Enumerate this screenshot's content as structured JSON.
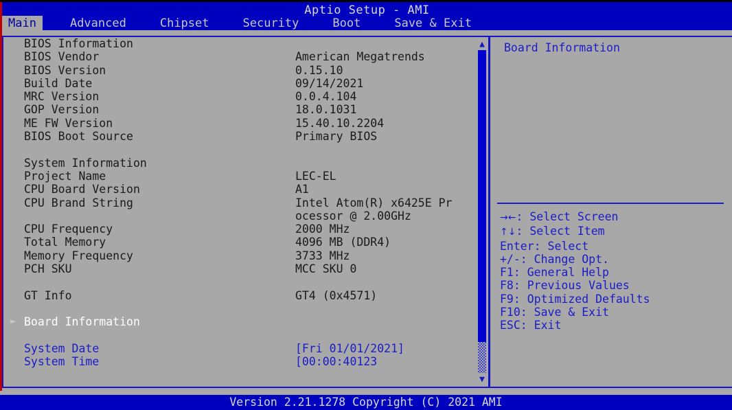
{
  "window": {
    "title": "Aptio Setup - AMI"
  },
  "tabs": [
    {
      "label": "Main",
      "active": true
    },
    {
      "label": "Advanced",
      "active": false
    },
    {
      "label": "Chipset",
      "active": false
    },
    {
      "label": "Security",
      "active": false
    },
    {
      "label": "Boot",
      "active": false
    },
    {
      "label": "Save & Exit",
      "active": false
    }
  ],
  "main": {
    "rows": [
      {
        "type": "item",
        "label": "BIOS Information",
        "value": "",
        "color": "dark"
      },
      {
        "type": "item",
        "label": "BIOS Vendor",
        "value": "American Megatrends",
        "color": "dark"
      },
      {
        "type": "item",
        "label": "BIOS Version",
        "value": "0.15.10",
        "color": "dark"
      },
      {
        "type": "item",
        "label": "Build Date",
        "value": "09/14/2021",
        "color": "dark"
      },
      {
        "type": "item",
        "label": "MRC Version",
        "value": "0.0.4.104",
        "color": "dark"
      },
      {
        "type": "item",
        "label": "GOP Version",
        "value": "18.0.1031",
        "color": "dark"
      },
      {
        "type": "item",
        "label": "ME FW Version",
        "value": "15.40.10.2204",
        "color": "dark"
      },
      {
        "type": "item",
        "label": "BIOS Boot Source",
        "value": "Primary BIOS",
        "color": "dark"
      },
      {
        "type": "spacer"
      },
      {
        "type": "item",
        "label": "System Information",
        "value": "",
        "color": "dark"
      },
      {
        "type": "item",
        "label": "Project Name",
        "value": "LEC-EL",
        "color": "dark"
      },
      {
        "type": "item",
        "label": "CPU Board Version",
        "value": "A1",
        "color": "dark"
      },
      {
        "type": "item",
        "label": "CPU Brand String",
        "value": "Intel Atom(R) x6425E Pr",
        "color": "dark"
      },
      {
        "type": "item",
        "label": "",
        "value": "ocessor @ 2.00GHz",
        "color": "dark"
      },
      {
        "type": "item",
        "label": "CPU Frequency",
        "value": "2000 MHz",
        "color": "dark"
      },
      {
        "type": "item",
        "label": "Total Memory",
        "value": "4096 MB (DDR4)",
        "color": "dark"
      },
      {
        "type": "item",
        "label": "Memory Frequency",
        "value": "3733 MHz",
        "color": "dark"
      },
      {
        "type": "item",
        "label": "PCH SKU",
        "value": "MCC SKU 0",
        "color": "dark"
      },
      {
        "type": "spacer"
      },
      {
        "type": "item",
        "label": "GT Info",
        "value": "GT4 (0x4571)",
        "color": "dark"
      },
      {
        "type": "spacer"
      },
      {
        "type": "submenu",
        "label": "Board Information",
        "value": "",
        "color": "white",
        "marker": "►"
      },
      {
        "type": "spacer"
      },
      {
        "type": "item",
        "label": "System Date",
        "value": "[Fri 01/01/2021]",
        "color": "blue"
      },
      {
        "type": "item",
        "label": "System Time",
        "value": "[00:00:40123",
        "color": "blue"
      }
    ]
  },
  "scrollbar": {
    "up_arrow": "▲",
    "down_arrow": "▼"
  },
  "help": {
    "title": "Board Information",
    "keys": [
      {
        "glyph": "→←",
        "text": ": Select Screen"
      },
      {
        "glyph": "↑↓",
        "text": ": Select Item"
      },
      {
        "glyph": "",
        "text": "Enter: Select"
      },
      {
        "glyph": "",
        "text": "+/-: Change Opt."
      },
      {
        "glyph": "",
        "text": "F1: General Help"
      },
      {
        "glyph": "",
        "text": "F8: Previous Values"
      },
      {
        "glyph": "",
        "text": "F9: Optimized Defaults"
      },
      {
        "glyph": "",
        "text": "F10: Save & Exit"
      },
      {
        "glyph": "",
        "text": "ESC: Exit"
      }
    ]
  },
  "footer": {
    "version_text": "Version 2.21.1278 Copyright (C) 2021 AMI"
  },
  "colors": {
    "blue": "#0000bf",
    "panel_bg": "#a8a8a8",
    "border": "#1414c8",
    "text_blue": "#1b1bc8",
    "text_dark": "#1a1a1a",
    "highlight": "#ffffff"
  }
}
